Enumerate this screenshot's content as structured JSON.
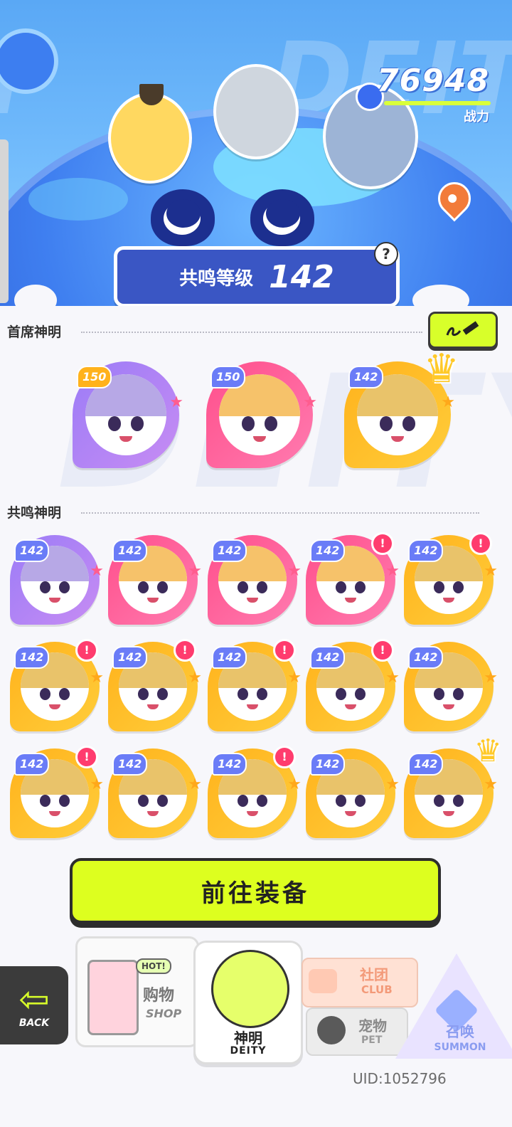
{
  "header": {
    "power_value": "76948",
    "power_label": "战力",
    "resonance_label": "共鸣等级",
    "resonance_level": "142",
    "help_symbol": "?",
    "bg_text": "DEITY"
  },
  "sections": {
    "primary_title": "首席神明",
    "resonance_title": "共鸣神明"
  },
  "primary_cards": [
    {
      "level": "150",
      "color": "purple"
    },
    {
      "level": "150",
      "color": "pink"
    },
    {
      "level": "142",
      "color": "gold",
      "crown": true
    }
  ],
  "resonance_cards": [
    {
      "level": "142",
      "color": "purple",
      "alert": false
    },
    {
      "level": "142",
      "color": "pink",
      "alert": false
    },
    {
      "level": "142",
      "color": "pink",
      "alert": false
    },
    {
      "level": "142",
      "color": "pink",
      "alert": true
    },
    {
      "level": "142",
      "color": "gold",
      "alert": true
    },
    {
      "level": "142",
      "color": "gold",
      "alert": true
    },
    {
      "level": "142",
      "color": "gold",
      "alert": true
    },
    {
      "level": "142",
      "color": "gold",
      "alert": true
    },
    {
      "level": "142",
      "color": "gold",
      "alert": true
    },
    {
      "level": "142",
      "color": "gold",
      "alert": false
    },
    {
      "level": "142",
      "color": "gold",
      "alert": true
    },
    {
      "level": "142",
      "color": "gold",
      "alert": false
    },
    {
      "level": "142",
      "color": "gold",
      "alert": true
    },
    {
      "level": "142",
      "color": "gold",
      "alert": false
    },
    {
      "level": "142",
      "color": "gold",
      "alert": false,
      "crown": true
    }
  ],
  "equip_button": "前往装备",
  "nav": {
    "back": "BACK",
    "shop_cn": "购物",
    "shop_en": "SHOP",
    "shop_badge": "HOT!",
    "deity_cn": "神明",
    "deity_en": "DEITY",
    "club_cn": "社团",
    "club_en": "CLUB",
    "pet_cn": "宠物",
    "pet_en": "PET",
    "summon_cn": "召唤",
    "summon_en": "SUMMON"
  },
  "uid": "UID:1052796",
  "colors": {
    "accent_lime": "#ddff1f",
    "header_blue": "#3a56c4",
    "alert_red": "#ff3c6e"
  }
}
